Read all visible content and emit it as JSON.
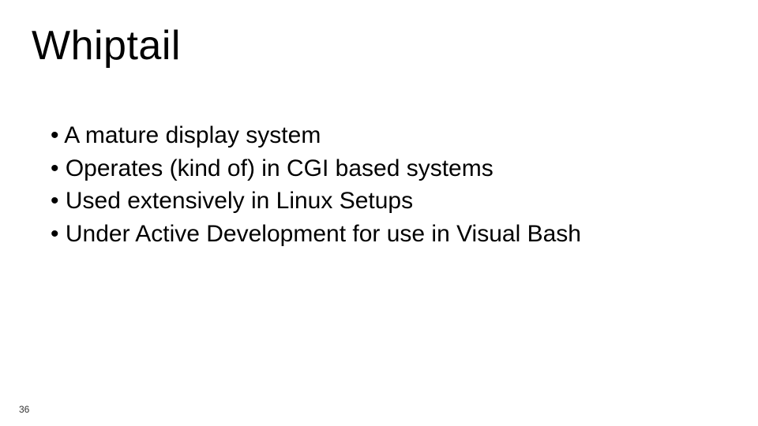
{
  "slide": {
    "title": "Whiptail",
    "bullets": [
      "A mature display system",
      "Operates (kind of) in CGI based systems",
      "Used extensively in Linux Setups",
      "Under Active Development for use in Visual Bash"
    ],
    "page_number": "36"
  }
}
